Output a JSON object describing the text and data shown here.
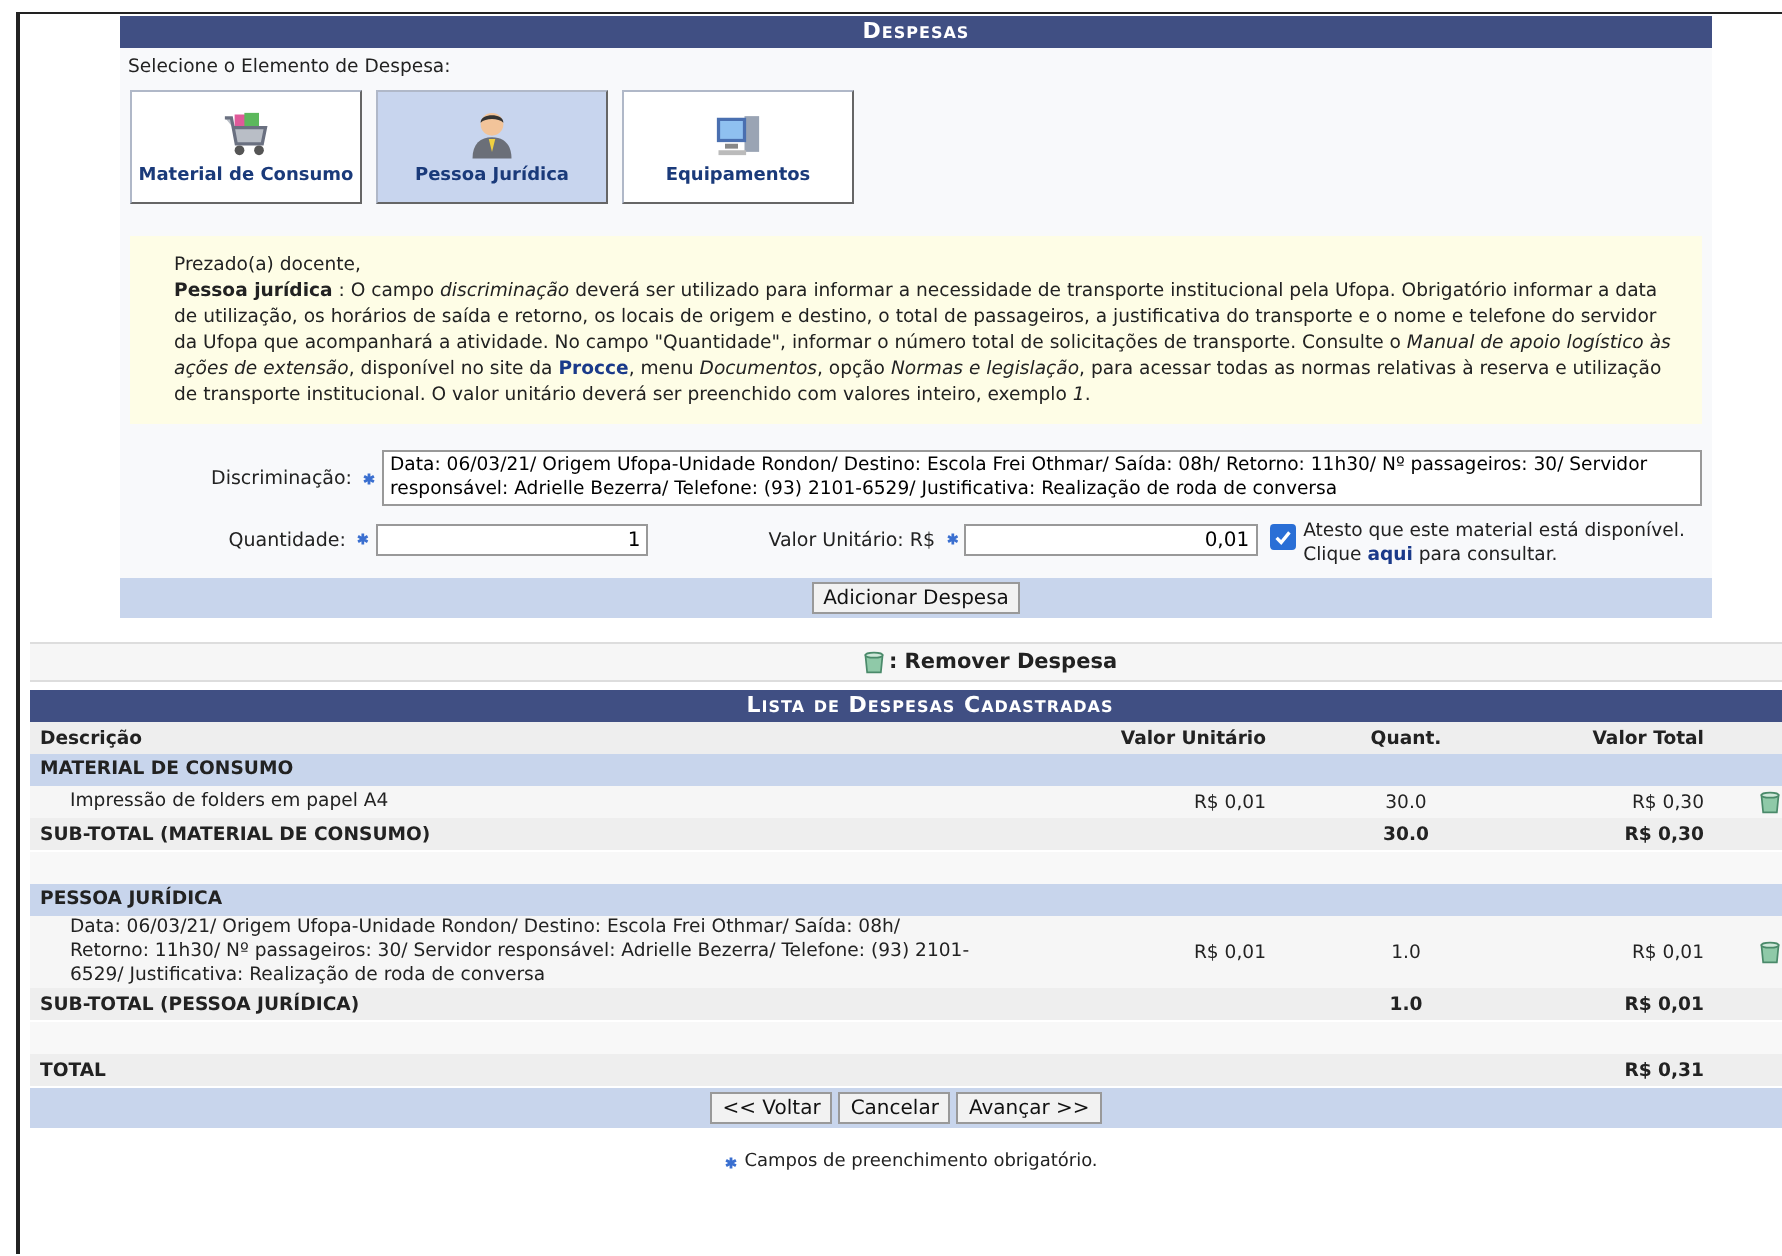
{
  "panel": {
    "title": "Despesas",
    "prompt": "Selecione o Elemento de Despesa:",
    "tabs": [
      {
        "label": "Material de Consumo",
        "selected": false
      },
      {
        "label": "Pessoa Jurídica",
        "selected": true
      },
      {
        "label": "Equipamentos",
        "selected": false
      }
    ],
    "notice": {
      "greeting": "Prezado(a) docente,",
      "parts": [
        {
          "kind": "text",
          "text": "**Pessoa jurídica** : O campo *discriminação* deverá ser utilizado para informar a necessidade de transporte institucional pela Ufopa. Obrigatório informar a data de utilização, os horários de saída e retorno, os locais de origem e destino, o total de passageiros, a justificativa do transporte e o nome e telefone do servidor da Ufopa que acompanhará a atividade. No campo \"Quantidade\", informar o número total de solicitações de transporte. Consulte o *Manual de apoio logístico às ações de extensão*, disponível no site da "
        },
        {
          "kind": "link",
          "text": "Procce"
        },
        {
          "kind": "text",
          "text": ", menu *Documentos*, opção *Normas e legislação*, para acessar todas as normas relativas à reserva e utilização de transporte institucional. O valor unitário deverá ser preenchido com valores inteiro, exemplo *1*."
        }
      ]
    },
    "form": {
      "description": {
        "label": "Discriminação:",
        "required": true,
        "value": "Data: 06/03/21/ Origem Ufopa-Unidade Rondon/ Destino: Escola Frei Othmar/ Saída: 08h/ Retorno: 11h30/ Nº passageiros: 30/ Servidor responsável: Adrielle Bezerra/ Telefone: (93) 2101-6529/ Justificativa: Realização de roda de conversa"
      },
      "quantity": {
        "label": "Quantidade:",
        "required": true,
        "value": "1"
      },
      "unit_value": {
        "label": "Valor Unitário: R$",
        "required": true,
        "value": "0,01"
      },
      "attest": {
        "checked": true,
        "text_before": "Atesto que este material está disponível. Clique ",
        "link": "aqui",
        "text_after": " para consultar."
      },
      "submit": "Adicionar Despesa"
    }
  },
  "legend": {
    "text": ": Remover Despesa"
  },
  "table": {
    "title": "Lista de Despesas Cadastradas",
    "columns": [
      "Descrição",
      "Valor Unitário",
      "Quant.",
      "Valor Total"
    ],
    "groups": [
      {
        "name": "MATERIAL DE CONSUMO",
        "items": [
          {
            "description": "Impressão de folders em papel A4",
            "unit_value": "R$ 0,01",
            "quantity": "30.0",
            "total": "R$ 0,30"
          }
        ],
        "subtotal": {
          "label": "SUB-TOTAL (MATERIAL DE CONSUMO)",
          "quantity": "30.0",
          "total": "R$ 0,30"
        }
      },
      {
        "name": "PESSOA JURÍDICA",
        "items": [
          {
            "description": "Data: 06/03/21/ Origem Ufopa-Unidade Rondon/ Destino: Escola Frei Othmar/ Saída: 08h/ Retorno: 11h30/ Nº passageiros: 30/ Servidor responsável: Adrielle Bezerra/ Telefone: (93) 2101-6529/ Justificativa: Realização de roda de conversa",
            "unit_value": "R$ 0,01",
            "quantity": "1.0",
            "total": "R$ 0,01"
          }
        ],
        "subtotal": {
          "label": "SUB-TOTAL (PESSOA JURÍDICA)",
          "quantity": "1.0",
          "total": "R$ 0,01"
        }
      }
    ],
    "total": {
      "label": "TOTAL",
      "value": "R$ 0,31"
    }
  },
  "buttons": [
    "<< Voltar",
    "Cancelar",
    "Avançar >>"
  ],
  "footnote": {
    "required": true,
    "text": "Campos de preenchimento obrigatório."
  }
}
